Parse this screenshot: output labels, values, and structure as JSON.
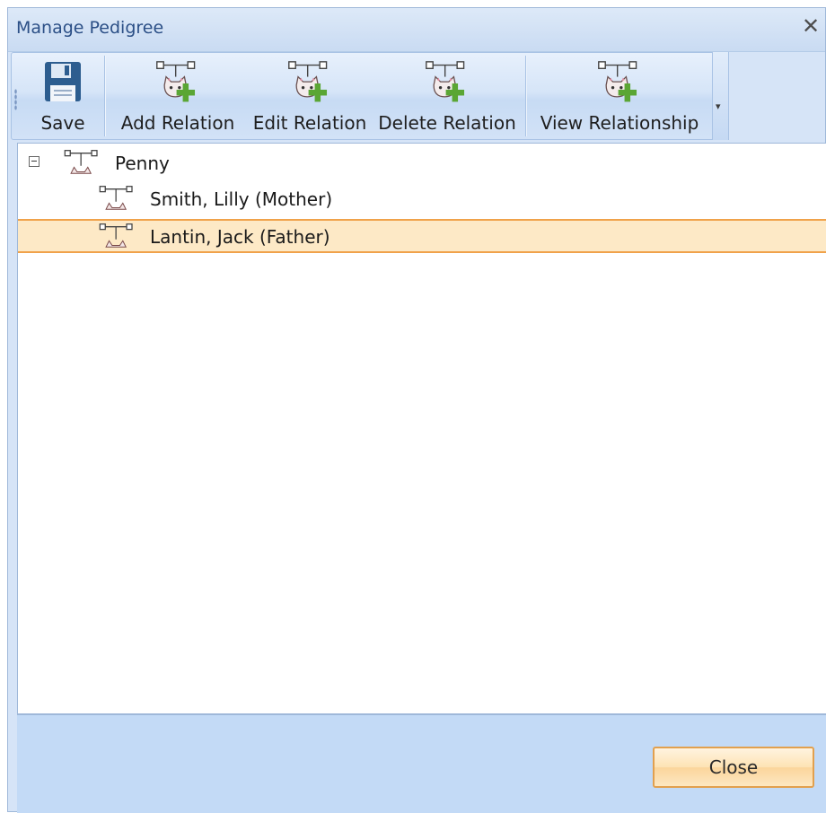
{
  "window": {
    "title": "Manage Pedigree"
  },
  "toolbar": {
    "save_label": "Save",
    "add_label": "Add Relation",
    "edit_label": "Edit Relation",
    "delete_label": "Delete Relation",
    "view_label": "View Relationship"
  },
  "tree": {
    "root": "Penny",
    "children": [
      "Smith, Lilly (Mother)",
      "Lantin, Jack (Father)"
    ],
    "selected_index": 1
  },
  "footer": {
    "close_label": "Close"
  },
  "colors": {
    "accent": "#2b4f86",
    "selection_bg": "#fde9c6",
    "selection_border": "#f0a24a",
    "plus_green": "#5aa634"
  }
}
